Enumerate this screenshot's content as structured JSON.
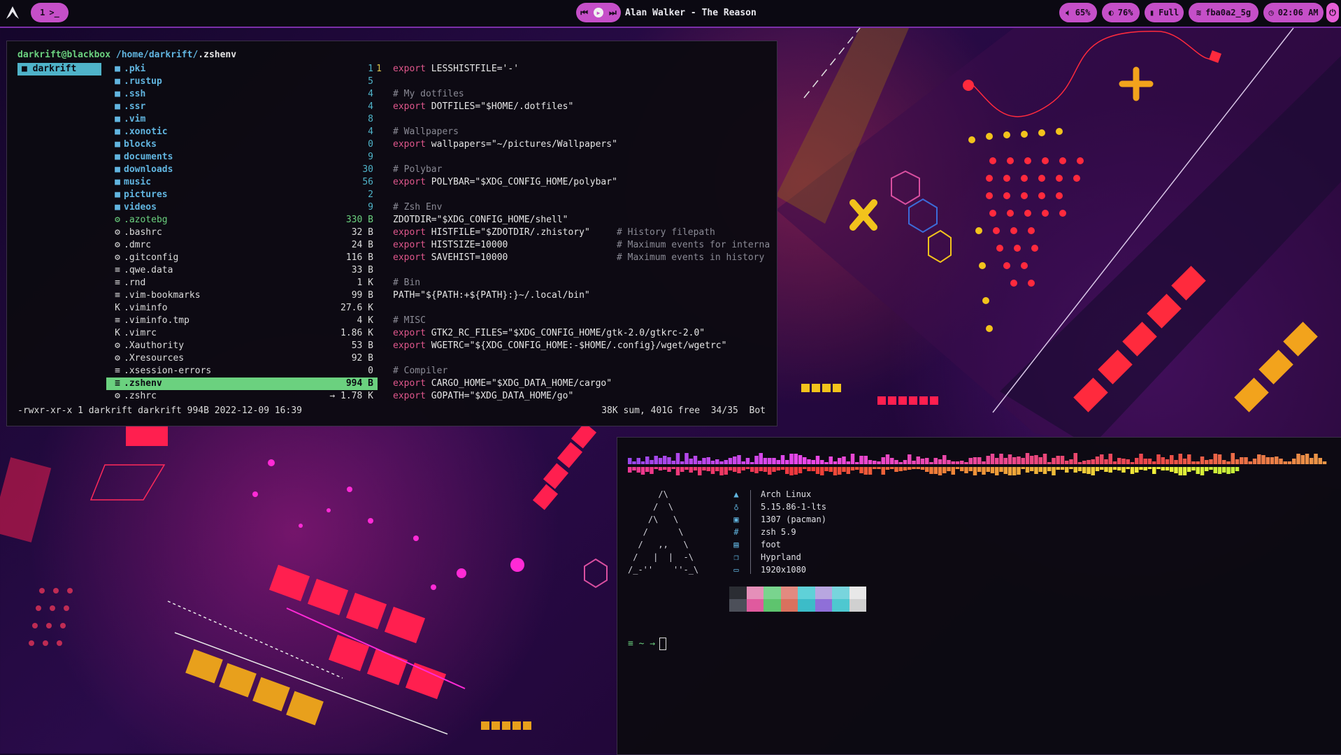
{
  "topbar": {
    "workspace": "1",
    "workspace_glyph": ">_",
    "now_playing": "Alan Walker - The Reason",
    "volume": "65%",
    "brightness": "76%",
    "battery": "Full",
    "wifi": "fba0a2_5g",
    "clock": "02:06 AM"
  },
  "lf": {
    "user_host": "darkrift@blackbox",
    "cwd": "/home/darkrift/",
    "file": ".zshenv",
    "parent_dir": "darkrift",
    "files": [
      {
        "icon": "folder-icon",
        "glyph": "■",
        "name": ".pki",
        "size": "1",
        "kind": "dir"
      },
      {
        "icon": "folder-icon",
        "glyph": "■",
        "name": ".rustup",
        "size": "5",
        "kind": "dir"
      },
      {
        "icon": "folder-icon",
        "glyph": "■",
        "name": ".ssh",
        "size": "4",
        "kind": "dir"
      },
      {
        "icon": "folder-icon",
        "glyph": "■",
        "name": ".ssr",
        "size": "4",
        "kind": "dir"
      },
      {
        "icon": "folder-icon",
        "glyph": "■",
        "name": ".vim",
        "size": "8",
        "kind": "dir"
      },
      {
        "icon": "folder-icon",
        "glyph": "■",
        "name": ".xonotic",
        "size": "4",
        "kind": "dir"
      },
      {
        "icon": "folder-icon",
        "glyph": "■",
        "name": "blocks",
        "size": "0",
        "kind": "dir"
      },
      {
        "icon": "folder-icon",
        "glyph": "■",
        "name": "documents",
        "size": "9",
        "kind": "dir"
      },
      {
        "icon": "folder-icon",
        "glyph": "■",
        "name": "downloads",
        "size": "30",
        "kind": "dir"
      },
      {
        "icon": "folder-icon",
        "glyph": "■",
        "name": "music",
        "size": "56",
        "kind": "dir"
      },
      {
        "icon": "folder-icon",
        "glyph": "■",
        "name": "pictures",
        "size": "2",
        "kind": "dir"
      },
      {
        "icon": "folder-icon",
        "glyph": "■",
        "name": "videos",
        "size": "9",
        "kind": "dir"
      },
      {
        "icon": "image-file-icon",
        "glyph": "⚙",
        "name": ".azotebg",
        "size": "330 B",
        "kind": "green"
      },
      {
        "icon": "gear-file-icon",
        "glyph": "⚙",
        "name": ".bashrc",
        "size": "32 B",
        "kind": "file"
      },
      {
        "icon": "gear-file-icon",
        "glyph": "⚙",
        "name": ".dmrc",
        "size": "24 B",
        "kind": "file"
      },
      {
        "icon": "gear-file-icon",
        "glyph": "⚙",
        "name": ".gitconfig",
        "size": "116 B",
        "kind": "file"
      },
      {
        "icon": "text-file-icon",
        "glyph": "≡",
        "name": ".qwe.data",
        "size": "33 B",
        "kind": "file"
      },
      {
        "icon": "text-file-icon",
        "glyph": "≡",
        "name": ".rnd",
        "size": "1 K",
        "kind": "file"
      },
      {
        "icon": "text-file-icon",
        "glyph": "≡",
        "name": ".vim-bookmarks",
        "size": "99 B",
        "kind": "file"
      },
      {
        "icon": "vim-file-icon",
        "glyph": "K",
        "name": ".viminfo",
        "size": "27.6 K",
        "kind": "file"
      },
      {
        "icon": "text-file-icon",
        "glyph": "≡",
        "name": ".viminfo.tmp",
        "size": "4 K",
        "kind": "file"
      },
      {
        "icon": "vim-file-icon",
        "glyph": "K",
        "name": ".vimrc",
        "size": "1.86 K",
        "kind": "file"
      },
      {
        "icon": "gear-file-icon",
        "glyph": "⚙",
        "name": ".Xauthority",
        "size": "53 B",
        "kind": "file"
      },
      {
        "icon": "gear-file-icon",
        "glyph": "⚙",
        "name": ".Xresources",
        "size": "92 B",
        "kind": "file"
      },
      {
        "icon": "text-file-icon",
        "glyph": "≡",
        "name": ".xsession-errors",
        "size": "0",
        "kind": "file"
      },
      {
        "icon": "text-file-icon",
        "glyph": "≡",
        "name": ".zshenv",
        "size": "994 B",
        "kind": "sel"
      },
      {
        "icon": "gear-file-icon",
        "glyph": "⚙",
        "name": ".zshrc",
        "size": "→ 1.78 K",
        "kind": "file"
      }
    ],
    "preview": [
      {
        "n": "1",
        "code": "export LESSHISTFILE='-'",
        "comment": false,
        "tail": ""
      },
      {
        "n": "",
        "code": "",
        "comment": false,
        "tail": ""
      },
      {
        "n": "",
        "code": "# My dotfiles",
        "comment": true,
        "tail": ""
      },
      {
        "n": "",
        "code": "export DOTFILES=\"$HOME/.dotfiles\"",
        "comment": false,
        "tail": ""
      },
      {
        "n": "",
        "code": "",
        "comment": false,
        "tail": ""
      },
      {
        "n": "",
        "code": "# Wallpapers",
        "comment": true,
        "tail": ""
      },
      {
        "n": "",
        "code": "export wallpapers=\"~/pictures/Wallpapers\"",
        "comment": false,
        "tail": ""
      },
      {
        "n": "",
        "code": "",
        "comment": false,
        "tail": ""
      },
      {
        "n": "",
        "code": "# Polybar",
        "comment": true,
        "tail": ""
      },
      {
        "n": "",
        "code": "export POLYBAR=\"$XDG_CONFIG_HOME/polybar\"",
        "comment": false,
        "tail": ""
      },
      {
        "n": "",
        "code": "",
        "comment": false,
        "tail": ""
      },
      {
        "n": "",
        "code": "# Zsh Env",
        "comment": true,
        "tail": ""
      },
      {
        "n": "",
        "code": "ZDOTDIR=\"$XDG_CONFIG_HOME/shell\"",
        "comment": false,
        "tail": ""
      },
      {
        "n": "",
        "code": "export HISTFILE=\"$ZDOTDIR/.zhistory\"",
        "comment": false,
        "tail": "# History filepath"
      },
      {
        "n": "",
        "code": "export HISTSIZE=10000",
        "comment": false,
        "tail": "# Maximum events for interna"
      },
      {
        "n": "",
        "code": "export SAVEHIST=10000",
        "comment": false,
        "tail": "# Maximum events in history"
      },
      {
        "n": "",
        "code": "",
        "comment": false,
        "tail": ""
      },
      {
        "n": "",
        "code": "# Bin",
        "comment": true,
        "tail": ""
      },
      {
        "n": "",
        "code": "PATH=\"${PATH:+${PATH}:}~/.local/bin\"",
        "comment": false,
        "tail": ""
      },
      {
        "n": "",
        "code": "",
        "comment": false,
        "tail": ""
      },
      {
        "n": "",
        "code": "# MISC",
        "comment": true,
        "tail": ""
      },
      {
        "n": "",
        "code": "export GTK2_RC_FILES=\"$XDG_CONFIG_HOME/gtk-2.0/gtkrc-2.0\"",
        "comment": false,
        "tail": ""
      },
      {
        "n": "",
        "code": "export WGETRC=\"${XDG_CONFIG_HOME:-$HOME/.config}/wget/wgetrc\"",
        "comment": false,
        "tail": ""
      },
      {
        "n": "",
        "code": "",
        "comment": false,
        "tail": ""
      },
      {
        "n": "",
        "code": "# Compiler",
        "comment": true,
        "tail": ""
      },
      {
        "n": "",
        "code": "export CARGO_HOME=\"$XDG_DATA_HOME/cargo\"",
        "comment": false,
        "tail": ""
      },
      {
        "n": "",
        "code": "export GOPATH=\"$XDG_DATA_HOME/go\"",
        "comment": false,
        "tail": ""
      }
    ],
    "status_left": "-rwxr-xr-x 1 darkrift darkrift 994B 2022-12-09 16:39",
    "status_right": "38K sum, 401G free  34/35  Bot"
  },
  "fetch": {
    "ascii_art": "      /\\\n     /  \\\n    /\\   \\\n   /      \\\n  /   ,,   \\\n /   |  |  -\\\n/_-''    ''-_\\",
    "info": [
      {
        "icon": "arch-icon",
        "glyph": "▲",
        "value": "Arch Linux"
      },
      {
        "icon": "kernel-icon",
        "glyph": "♁",
        "value": "5.15.86-1-lts"
      },
      {
        "icon": "package-icon",
        "glyph": "▣",
        "value": "1307 (pacman)"
      },
      {
        "icon": "shell-icon",
        "glyph": "#",
        "value": "zsh 5.9"
      },
      {
        "icon": "terminal-icon",
        "glyph": "▤",
        "value": "foot"
      },
      {
        "icon": "window-manager-icon",
        "glyph": "❐",
        "value": "Hyprland"
      },
      {
        "icon": "monitor-icon",
        "glyph": "▭",
        "value": "1920x1080"
      }
    ],
    "palette": [
      "#2b2d33",
      "#e58fb9",
      "#79d48e",
      "#e38a80",
      "#5fd1d8",
      "#b8a6e0",
      "#78d5dd",
      "#e8e8e8",
      "#4c4f59",
      "#e05a9e",
      "#5ec46e",
      "#d9715e",
      "#3cbcc8",
      "#8f6fd8",
      "#4ec8d0",
      "#d0d0d0"
    ],
    "prompt": "≡ ~ →"
  },
  "colors": {
    "accent": "#c54fc8",
    "dir": "#61b5e0",
    "green": "#6bd17f",
    "linenum": "#d9c34a",
    "keyword": "#e0578c"
  }
}
